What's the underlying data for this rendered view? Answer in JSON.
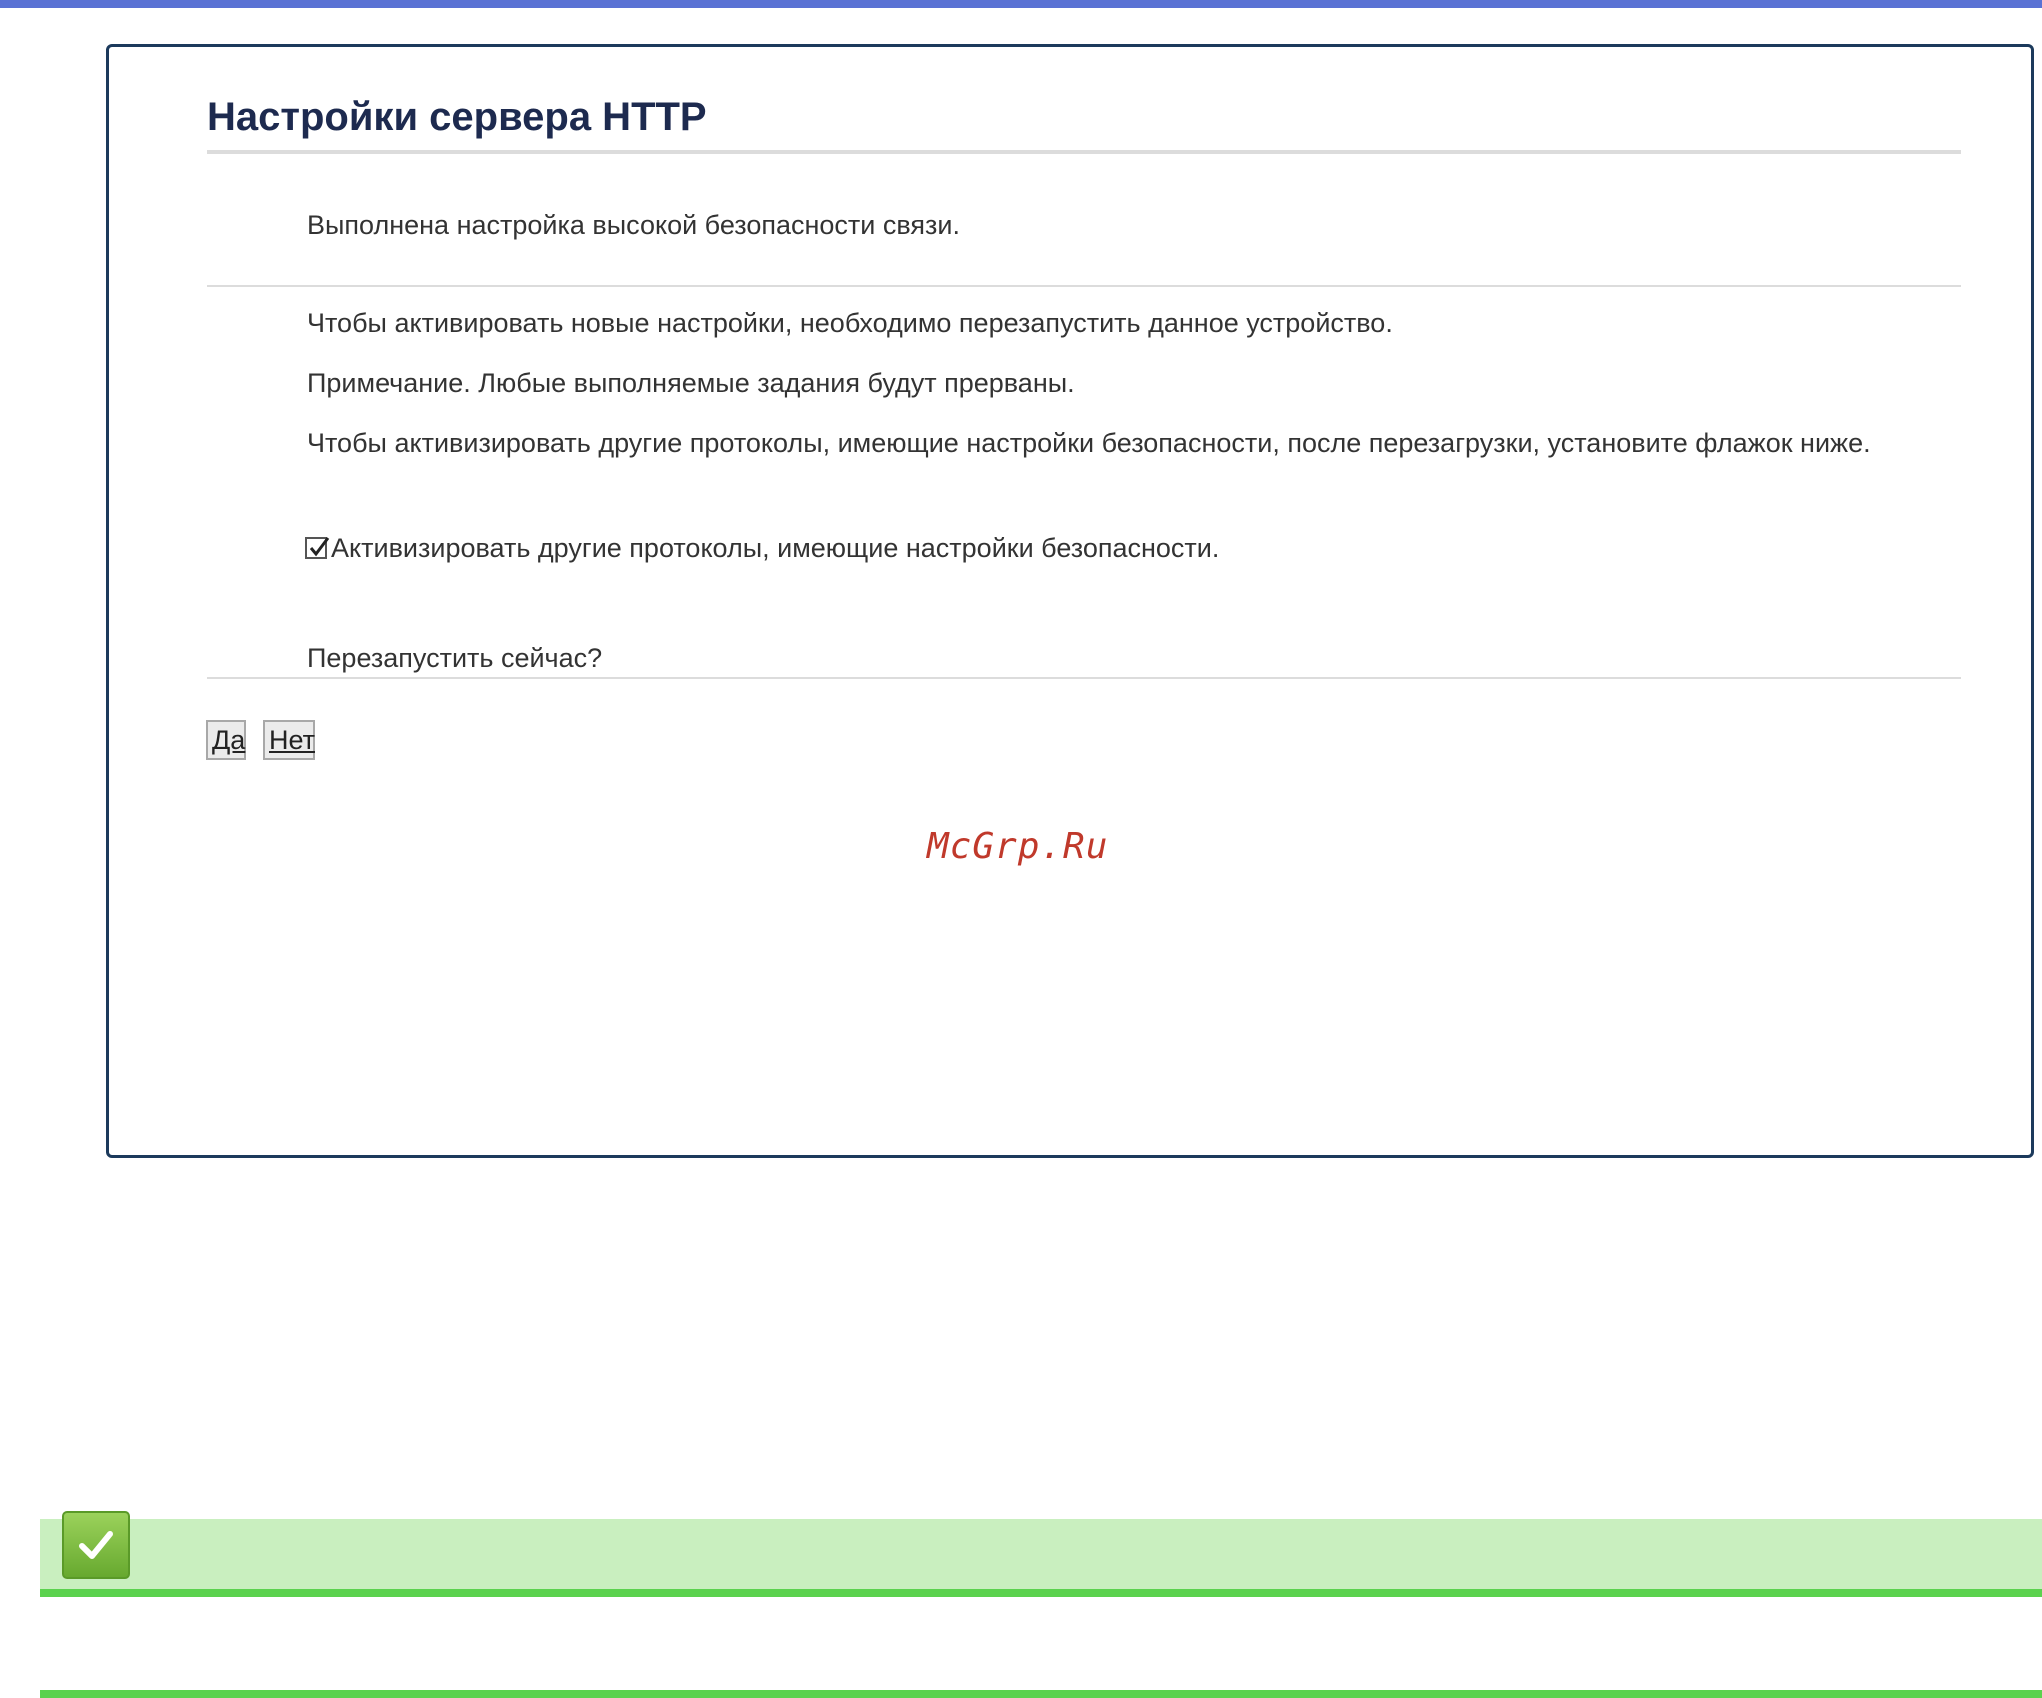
{
  "panel": {
    "title": "Настройки сервера HTTP",
    "status_message": "Выполнена настройка высокой безопасности связи.",
    "restart_info": "Чтобы активировать новые настройки, необходимо перезапустить данное устройство.",
    "note": "Примечание. Любые выполняемые задания будут прерваны.",
    "protocols_hint": "Чтобы активизировать другие протоколы, имеющие настройки безопасности, после перезагрузки, установите флажок ниже.",
    "checkbox": {
      "label": "Активизировать другие протоколы, имеющие настройки безопасности.",
      "checked": true
    },
    "restart_question": "Перезапустить сейчас?",
    "buttons": {
      "yes_label": "Да",
      "no_label": "Нет"
    }
  },
  "watermark": "McGrp.Ru",
  "icons": {
    "checkbox_mark": "checkmark-icon",
    "note_icon": "check-note-icon"
  },
  "colors": {
    "top_bar": "#5a72d4",
    "panel_border": "#1c3a5c",
    "title": "#1d2a4f",
    "watermark": "#c0392b",
    "note_background": "#c9efbf",
    "note_accent": "#5bd24e"
  }
}
